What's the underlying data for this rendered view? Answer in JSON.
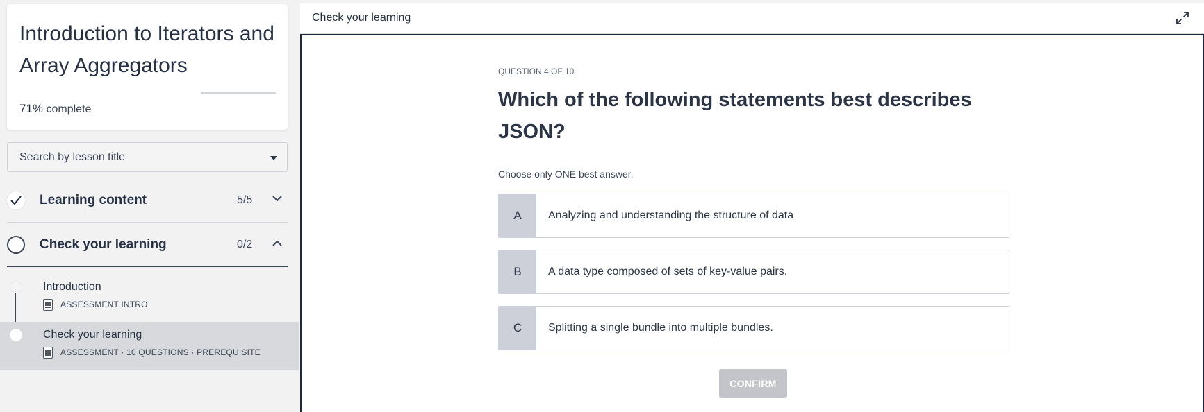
{
  "course": {
    "title": "Introduction to Iterators and Array Aggregators",
    "progress_percent": "71%",
    "progress_label": "complete",
    "progress_fraction": 0.0
  },
  "search": {
    "label": "Search by lesson title"
  },
  "sections": [
    {
      "title": "Learning content",
      "count": "5/5",
      "status": "complete",
      "expanded": false
    },
    {
      "title": "Check your learning",
      "count": "0/2",
      "status": "not-started",
      "expanded": true
    }
  ],
  "lessons": [
    {
      "name": "Introduction",
      "meta": "ASSESSMENT INTRO"
    },
    {
      "name": "Check your learning",
      "meta": "ASSESSMENT · 10 QUESTIONS · PREREQUISITE"
    }
  ],
  "panel": {
    "title": "Check your learning"
  },
  "question": {
    "counter": "QUESTION 4 OF 10",
    "text": "Which of the following statements best describes JSON?",
    "instruction": "Choose only ONE best answer.",
    "options": [
      {
        "letter": "A",
        "text": "Analyzing and understanding the structure of data"
      },
      {
        "letter": "B",
        "text": "A data type composed of sets of key-value pairs."
      },
      {
        "letter": "C",
        "text": "Splitting a single bundle into multiple bundles."
      }
    ],
    "confirm_label": "CONFIRM"
  },
  "icons": {
    "check": "check-icon",
    "chevron_down": "chevron-down-icon",
    "chevron_up": "chevron-up-icon",
    "expand": "expand-icon",
    "caret": "caret-down-icon",
    "document": "document-icon"
  }
}
